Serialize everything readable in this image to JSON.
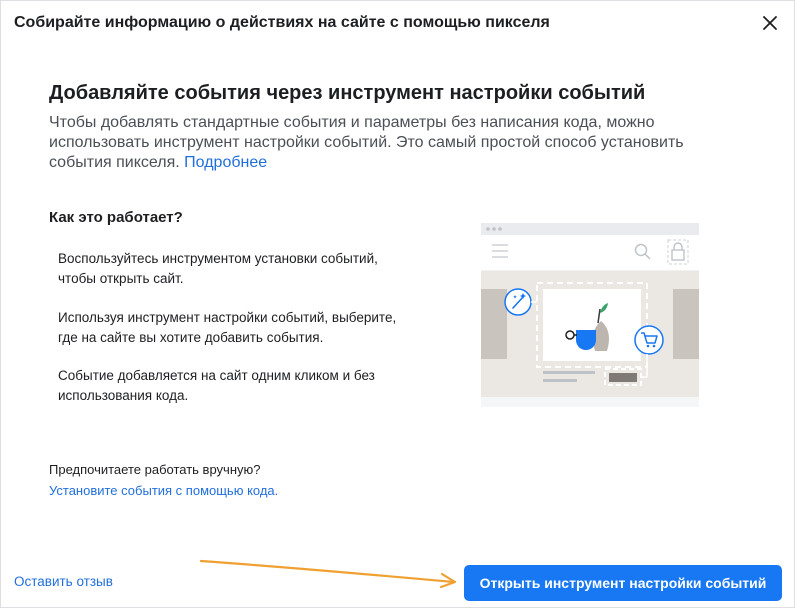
{
  "dialog": {
    "title": "Собирайте информацию о действиях на сайте с помощью пикселя",
    "close_icon": "close-icon"
  },
  "intro": {
    "headline": "Добавляйте события через инструмент настройки событий",
    "description": "Чтобы добавлять стандартные события и параметры без написания кода, можно использовать инструмент настройки событий. Это самый простой способ установить события пикселя.",
    "learn_more": "Подробнее"
  },
  "how_it_works": {
    "title": "Как это работает?",
    "steps": [
      "Воспользуйтесь инструментом установки событий, чтобы открыть сайт.",
      "Используя инструмент настройки событий, выберите, где на сайте вы хотите добавить события.",
      "Событие добавляется на сайт одним кликом и без использования кода."
    ]
  },
  "manual": {
    "question": "Предпочитаете работать вручную?",
    "link": "Установите события с помощью кода."
  },
  "footer": {
    "feedback": "Оставить отзыв",
    "primary_button": "Открыть инструмент настройки событий"
  },
  "colors": {
    "primary": "#1877f2",
    "link": "#216fdb",
    "annotation_arrow": "#f0a030"
  },
  "icons": {
    "illustration": "website-event-setup-illustration",
    "magic_wand": "magic-wand-icon",
    "cart": "shopping-cart-icon",
    "search": "search-icon",
    "lock": "lock-icon",
    "menu": "menu-icon"
  }
}
